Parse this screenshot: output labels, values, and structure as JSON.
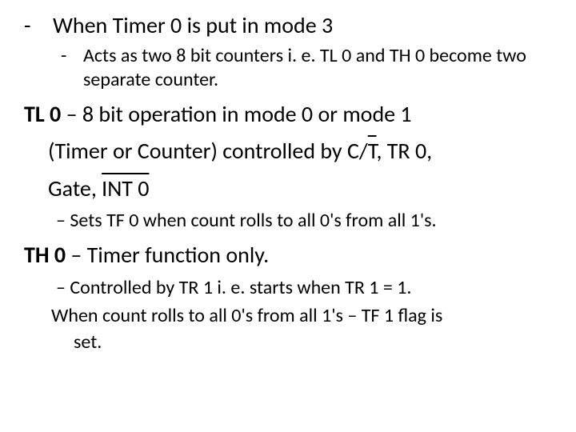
{
  "bullet1": {
    "dash": "-",
    "text": "When Timer 0 is put in mode 3"
  },
  "bullet1_sub": {
    "dash": "-",
    "text": "Acts as two 8 bit counters i. e. TL 0 and TH 0 become two separate counter."
  },
  "tl0": {
    "lead": "TL 0",
    "rest1": " – 8 bit operation in mode 0 or mode 1",
    "line2a": "(Timer or Counter) controlled by C/",
    "line2_ovT": "T",
    "line2b": ", TR 0,",
    "line3a": "Gate, ",
    "line3_ovINT0": "INT 0"
  },
  "tl0_sub": {
    "text": "– Sets TF 0 when count rolls to all 0's from all 1's."
  },
  "th0": {
    "lead": "TH 0",
    "rest": " – Timer function only."
  },
  "th0_sub": {
    "line1": "– Controlled by TR 1 i. e. starts when TR 1 = 1.",
    "line2": "When count rolls to all 0's from all 1's – TF 1 flag is",
    "line3": "set."
  }
}
